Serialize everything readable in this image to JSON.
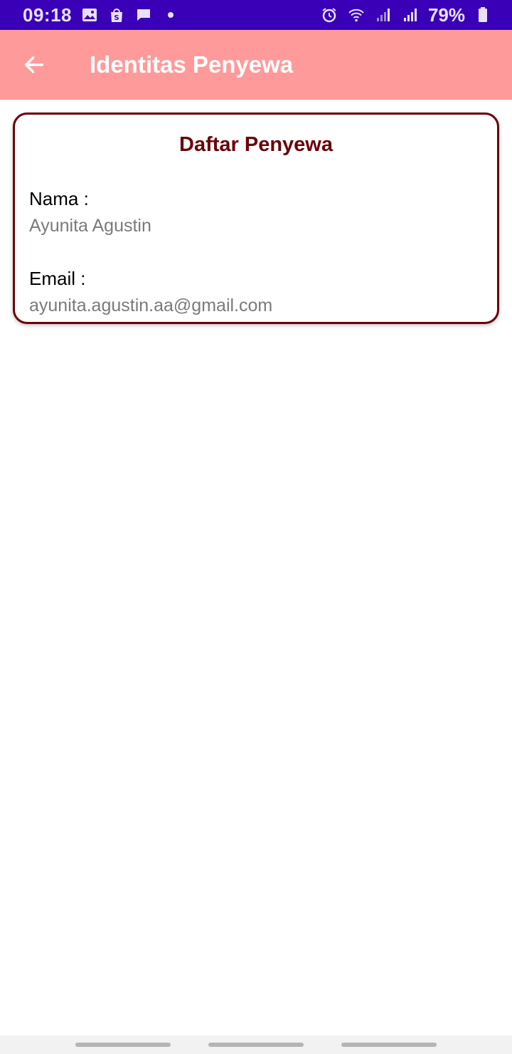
{
  "status_bar": {
    "time": "09:18",
    "battery": "79%",
    "left_icons": [
      "gallery-icon",
      "shopee-icon",
      "message-icon",
      "dot-icon"
    ],
    "right_icons": [
      "alarm-icon",
      "wifi-icon",
      "signal-icon",
      "signal-icon",
      "battery-icon"
    ],
    "bg_color": "#3a00b8"
  },
  "app_bar": {
    "title": "Identitas Penyewa",
    "bg_color": "#ff9a9a"
  },
  "card": {
    "title": "Daftar Penyewa",
    "name_label": "Nama :",
    "name_value": "Ayunita Agustin",
    "email_label": "Email :",
    "email_value": "ayunita.agustin.aa@gmail.com",
    "border_color": "#6a0008"
  }
}
